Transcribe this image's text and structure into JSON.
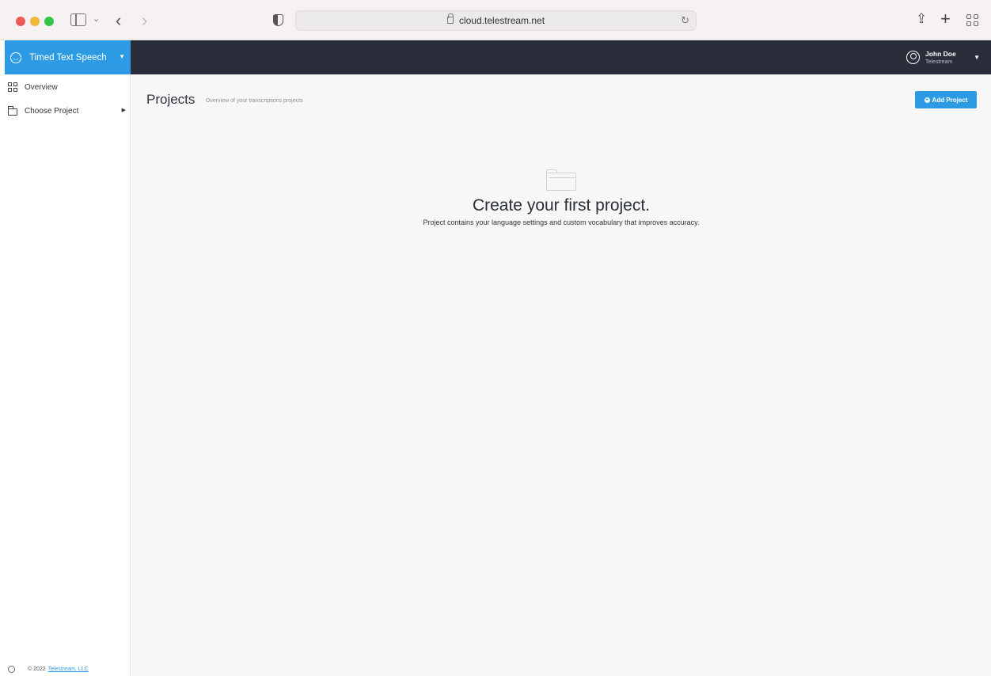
{
  "browser": {
    "url": "cloud.telestream.net"
  },
  "app": {
    "brand_label": "Timed Text Speech",
    "user": {
      "name": "John Doe",
      "org": "Telestream"
    }
  },
  "sidebar": {
    "items": [
      {
        "label": "Overview"
      },
      {
        "label": "Choose Project"
      }
    ],
    "footer": {
      "copyright": "© 2022",
      "link": "Telestream, LLC"
    }
  },
  "main": {
    "title": "Projects",
    "subtitle": "Overview of your transcriptions projects",
    "add_button": "Add Project",
    "empty_state": {
      "title": "Create your first project.",
      "description": "Project contains your language settings and custom vocabulary that improves accuracy."
    }
  },
  "colors": {
    "accent": "#2c9be3",
    "header_bg": "#292e3a"
  }
}
